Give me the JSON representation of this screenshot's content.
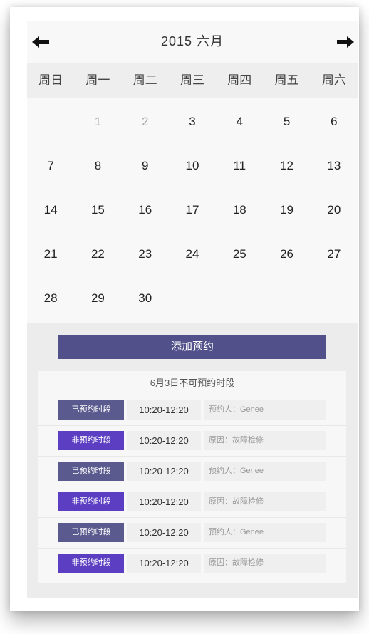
{
  "calendar": {
    "title": "2015 六月",
    "weekdays": [
      "周日",
      "周一",
      "周二",
      "周三",
      "周四",
      "周五",
      "周六"
    ],
    "days": [
      "",
      "1",
      "2",
      "3",
      "4",
      "5",
      "6",
      "7",
      "8",
      "9",
      "10",
      "11",
      "12",
      "13",
      "14",
      "15",
      "16",
      "17",
      "18",
      "19",
      "20",
      "21",
      "22",
      "23",
      "24",
      "25",
      "26",
      "27",
      "28",
      "29",
      "30",
      "",
      "",
      "",
      ""
    ]
  },
  "actions": {
    "add_label": "添加预约"
  },
  "schedule": {
    "title": "6月3日不可预约时段",
    "rows": [
      {
        "badge": "已预约时段",
        "time": "10:20-12:20",
        "info": "预约人：Genee",
        "type": "booked"
      },
      {
        "badge": "非预约时段",
        "time": "10:20-12:20",
        "info": "原因：故障检修",
        "type": "blocked"
      },
      {
        "badge": "已预约时段",
        "time": "10:20-12:20",
        "info": "预约人：Genee",
        "type": "booked"
      },
      {
        "badge": "非预约时段",
        "time": "10:20-12:20",
        "info": "原因：故障检修",
        "type": "blocked"
      },
      {
        "badge": "已预约时段",
        "time": "10:20-12:20",
        "info": "预约人：Genee",
        "type": "booked"
      },
      {
        "badge": "非预约时段",
        "time": "10:20-12:20",
        "info": "原因：故障检修",
        "type": "blocked"
      }
    ]
  },
  "colors": {
    "booked": "#5a5a8e",
    "blocked": "#5b3ec2",
    "button": "#51508a"
  },
  "icons": {
    "prev": "arrow-left-icon",
    "next": "arrow-right-icon"
  }
}
